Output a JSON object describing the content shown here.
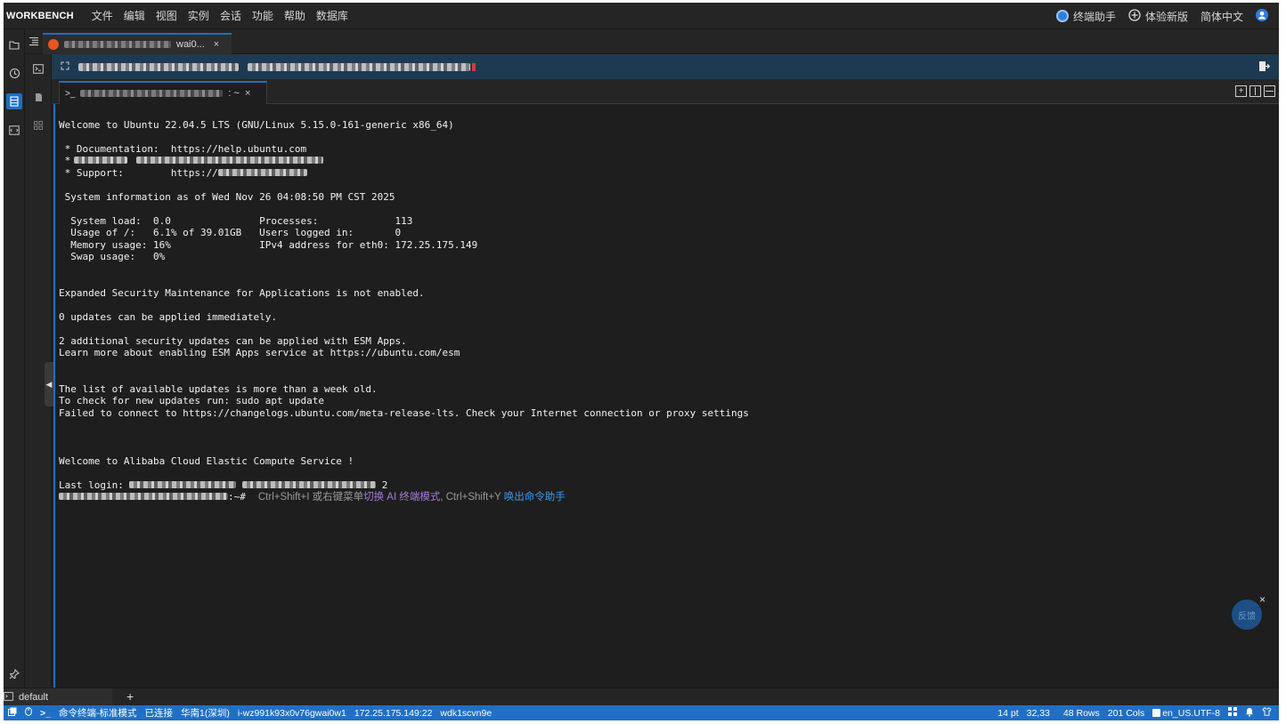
{
  "menubar": {
    "brand": "WORKBENCH",
    "items": [
      "文件",
      "编辑",
      "视图",
      "实例",
      "会话",
      "功能",
      "帮助",
      "数据库"
    ],
    "assistant": "终端助手",
    "new_version": "体验新版",
    "language": "简体中文"
  },
  "session_tab": {
    "label_suffix": "wai0...",
    "close": "×"
  },
  "terminal_tab": {
    "label_suffix": ": ~",
    "close": "×"
  },
  "terminal": {
    "lines": [
      "Welcome to Ubuntu 22.04.5 LTS (GNU/Linux 5.15.0-161-generic x86_64)",
      "",
      " * Documentation:  https://help.ubuntu.com",
      " *",
      " * Support:        https://",
      "",
      " System information as of Wed Nov 26 04:08:50 PM CST 2025",
      "",
      "  System load:  0.0               Processes:             113",
      "  Usage of /:   6.1% of 39.01GB   Users logged in:       0",
      "  Memory usage: 16%               IPv4 address for eth0: 172.25.175.149",
      "  Swap usage:   0%",
      "",
      "",
      "Expanded Security Maintenance for Applications is not enabled.",
      "",
      "0 updates can be applied immediately.",
      "",
      "2 additional security updates can be applied with ESM Apps.",
      "Learn more about enabling ESM Apps service at https://ubuntu.com/esm",
      "",
      "",
      "The list of available updates is more than a week old.",
      "To check for new updates run: sudo apt update",
      "Failed to connect to https://changelogs.ubuntu.com/meta-release-lts. Check your Internet connection or proxy settings",
      "",
      "",
      "",
      "Welcome to Alibaba Cloud Elastic Compute Service !",
      ""
    ],
    "last_login_label": "Last login:",
    "last_login_tail": "2",
    "prompt_suffix": ":~#",
    "hint_prefix": "Ctrl+Shift+I 或右键菜单",
    "hint_link1": "切换 AI 终端模式",
    "hint_mid": ", Ctrl+Shift+Y ",
    "hint_link2": "唤出命令助手"
  },
  "floating": {
    "label": "反馈",
    "close": "×"
  },
  "bottom_tabs": {
    "default_label": "default",
    "add": "+"
  },
  "statusbar": {
    "mode": "命令终端-标准模式",
    "connection": "已连接",
    "region": "华南1(深圳)",
    "instance_id": "i-wz991k93x0v76gwai0w1",
    "ip": "172.25.175.149:22",
    "session_id": "wdk1scvn9e",
    "font_size": "14 pt",
    "cursor": "32,33",
    "rows": "48 Rows",
    "cols": "201 Cols",
    "locale": "en_US.UTF-8"
  },
  "colors": {
    "accent": "#1f6fc6",
    "terminal_bg": "#1e1e1e",
    "infobar_bg": "#1d3a52",
    "hint_purple": "#a77bdc",
    "hint_blue": "#3b9bf0"
  }
}
